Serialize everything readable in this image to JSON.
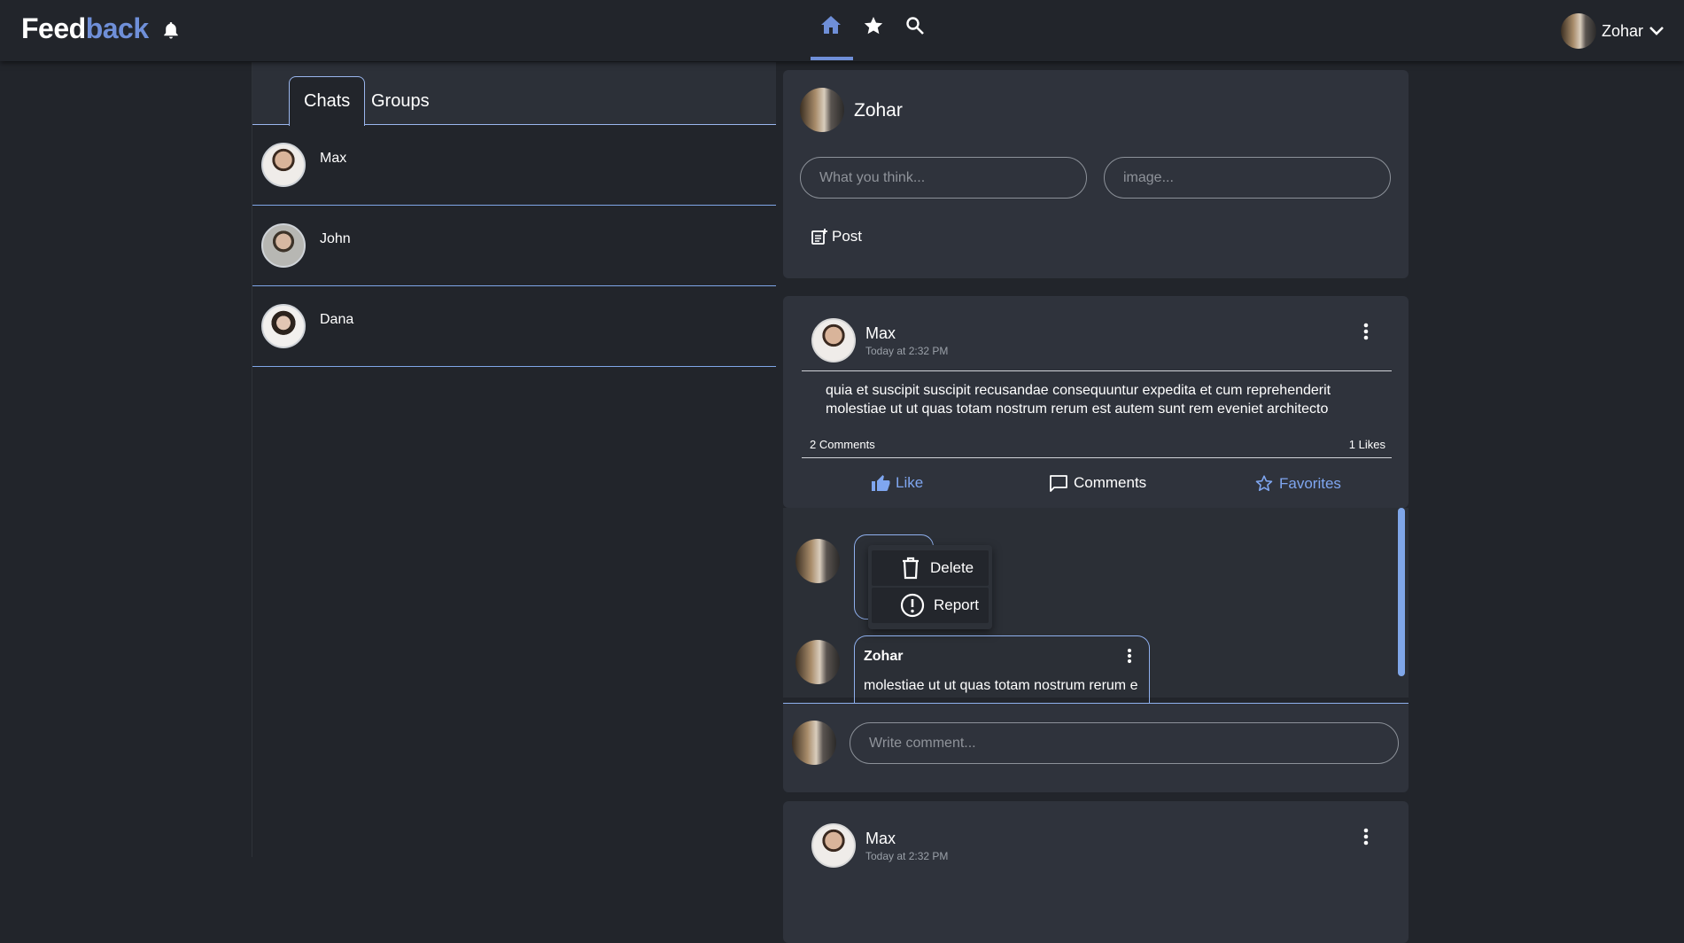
{
  "header": {
    "logo_part1": "Feed",
    "logo_part2": "back",
    "user_name": "Zohar",
    "accent_color": "#6f8fd8"
  },
  "nav": {
    "active": "home",
    "items": [
      "home-icon",
      "star-icon",
      "search-icon"
    ]
  },
  "chats": {
    "tabs": [
      "Chats",
      "Groups"
    ],
    "active_tab": "Chats",
    "items": [
      {
        "name": "Max"
      },
      {
        "name": "John"
      },
      {
        "name": "Dana"
      }
    ]
  },
  "compose": {
    "user_name": "Zohar",
    "text_placeholder": "What you think...",
    "image_placeholder": "image...",
    "post_label": "Post"
  },
  "posts": [
    {
      "author": "Max",
      "time": "Today at 2:32 PM",
      "text_line1": "quia et suscipit suscipit recusandae consequuntur expedita et cum reprehenderit",
      "text_line2": "molestiae ut ut quas totam nostrum rerum est autem sunt rem eveniet architecto",
      "comments_count": "2 Comments",
      "likes_count": "1 Likes",
      "actions": {
        "like": "Like",
        "comments": "Comments",
        "favorites": "Favorites"
      },
      "context_menu": {
        "delete": "Delete",
        "report": "Report"
      },
      "comments": [
        {
          "author": "",
          "text": ""
        },
        {
          "author": "Zohar",
          "text": "molestiae ut ut quas totam nostrum rerum e"
        }
      ],
      "comment_placeholder": "Write comment..."
    },
    {
      "author": "Max",
      "time": "Today at 2:32 PM"
    }
  ]
}
